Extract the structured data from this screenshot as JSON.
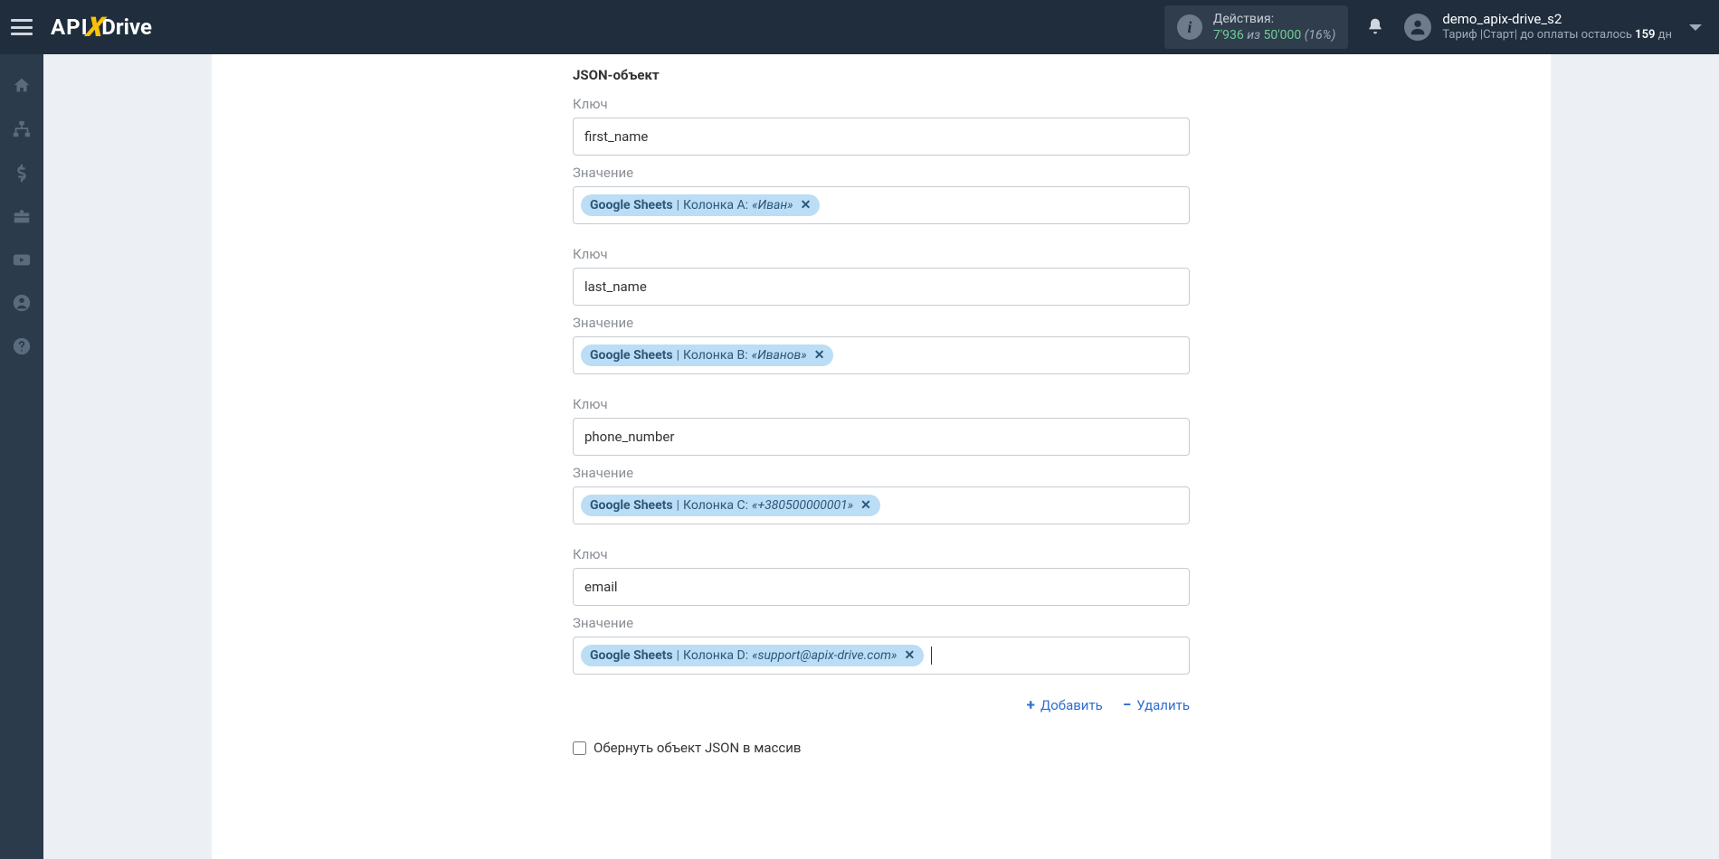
{
  "topbar": {
    "actions_label": "Действия:",
    "used": "7'936",
    "of": "из",
    "limit": "50'000",
    "pct": "(16%)",
    "username": "demo_apix-drive_s2",
    "tariff_prefix": "Тариф |Старт| до оплаты осталось ",
    "tariff_days": "159",
    "tariff_suffix": " дн"
  },
  "form": {
    "section_title": "JSON-объект",
    "key_label": "Ключ",
    "value_label": "Значение",
    "pairs": [
      {
        "key": "first_name",
        "source": "Google Sheets",
        "column": "Колонка A:",
        "sample": "«Иван»"
      },
      {
        "key": "last_name",
        "source": "Google Sheets",
        "column": "Колонка B:",
        "sample": "«Иванов»"
      },
      {
        "key": "phone_number",
        "source": "Google Sheets",
        "column": "Колонка C:",
        "sample": "«+380500000001»"
      },
      {
        "key": "email",
        "source": "Google Sheets",
        "column": "Колонка D:",
        "sample": "«support@apix-drive.com»"
      }
    ],
    "add_label": "Добавить",
    "delete_label": "Удалить",
    "wrap_checkbox_label": "Обернуть объект JSON в массив"
  }
}
